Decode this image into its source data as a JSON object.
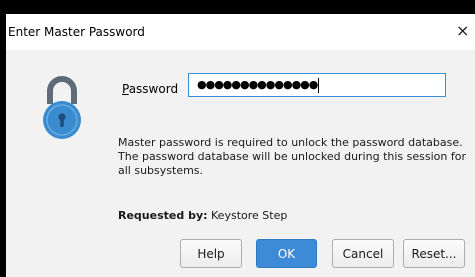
{
  "dialog": {
    "title": "Enter Master Password",
    "close_glyph": "×",
    "icon": "lock-icon",
    "password": {
      "label_mnemonic": "P",
      "label_rest": "assword",
      "masked_value": "●●●●●●●●●●●●●●"
    },
    "message": "Master password is required to unlock the password database. The password database will be unlocked during this session for all subsystems.",
    "requested_by": {
      "label": "Requested by:",
      "value": "Keystore Step"
    },
    "buttons": {
      "help": "Help",
      "ok": "OK",
      "cancel": "Cancel",
      "reset": "Reset..."
    },
    "colors": {
      "accent": "#3d8ad6",
      "lock_body": "#3a8ccf",
      "lock_shackle": "#5f6b76"
    }
  }
}
